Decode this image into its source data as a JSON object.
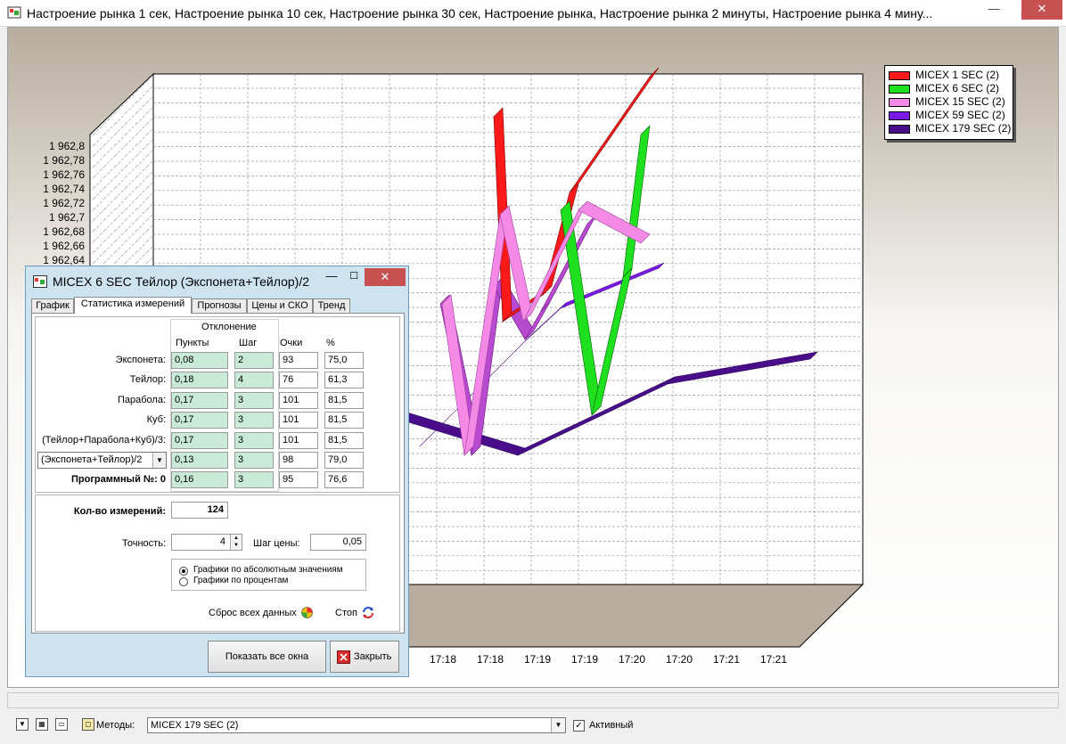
{
  "window": {
    "title": "Настроение рынка 1 сек, Настроение рынка 10 сек, Настроение рынка 30 сек, Настроение рынка, Настроение рынка 2 минуты, Настроение рынка 4 мину...",
    "minimize_glyph": "—",
    "close_glyph": "✕"
  },
  "chart": {
    "y_ticks": [
      "1 962,8",
      "1 962,78",
      "1 962,76",
      "1 962,74",
      "1 962,72",
      "1 962,7",
      "1 962,68",
      "1 962,66",
      "1 962,64"
    ],
    "x_ticks": [
      "17:18",
      "17:18",
      "17:19",
      "17:19",
      "17:20",
      "17:20",
      "17:21",
      "17:21"
    ],
    "legend": [
      {
        "label": "MICEX 1 SEC (2)",
        "color": "#ff1a1a"
      },
      {
        "label": "MICEX 6 SEC (2)",
        "color": "#1ee01e"
      },
      {
        "label": "MICEX 15 SEC (2)",
        "color": "#f48ae6"
      },
      {
        "label": "MICEX 59 SEC (2)",
        "color": "#7a1ae6"
      },
      {
        "label": "MICEX 179 SEC (2)",
        "color": "#4a0d8a"
      }
    ]
  },
  "dialog": {
    "title": "MICEX 6 SEC Тейлор (Экспонета+Тейлор)/2",
    "minimize_glyph": "—",
    "maximize_glyph": "☐",
    "close_glyph": "✕",
    "tabs": [
      "График",
      "Статистика измерений",
      "Прогнозы",
      "Цены и СКО",
      "Тренд"
    ],
    "deviation_header": "Отклонение",
    "columns": [
      "Пункты",
      "Шаг",
      "Очки",
      "%"
    ],
    "rows": [
      {
        "label": "Экспонета:",
        "points": "0,08",
        "step": "2",
        "score": "93",
        "pct": "75,0"
      },
      {
        "label": "Тейлор:",
        "points": "0,18",
        "step": "4",
        "score": "76",
        "pct": "61,3"
      },
      {
        "label": "Парабола:",
        "points": "0,17",
        "step": "3",
        "score": "101",
        "pct": "81,5"
      },
      {
        "label": "Куб:",
        "points": "0,17",
        "step": "3",
        "score": "101",
        "pct": "81,5"
      },
      {
        "label": "(Тейлор+Парабола+Куб)/3:",
        "points": "0,17",
        "step": "3",
        "score": "101",
        "pct": "81,5"
      },
      {
        "label": "(Экспонета+Тейлор)/2",
        "points": "0,13",
        "step": "3",
        "score": "98",
        "pct": "79,0"
      },
      {
        "label": "Программный №: 0",
        "points": "0,16",
        "step": "3",
        "score": "95",
        "pct": "76,6"
      }
    ],
    "count_label": "Кол-во измерений:",
    "count_value": "124",
    "precision_label": "Точность:",
    "precision_value": "4",
    "price_step_label": "Шаг цены:",
    "price_step_value": "0,05",
    "radio_abs": "Графики по абсолютным значениям",
    "radio_pct": "Графики по процентам",
    "reset_label": "Сброс всех данных",
    "stop_label": "Стоп",
    "show_all_label": "Показать все окна",
    "close_label": "Закрыть"
  },
  "bottom": {
    "methods_label": "Методы:",
    "methods_value": "MICEX 179 SEC (2)",
    "active_label": "Активный",
    "active_checked": "✓"
  }
}
